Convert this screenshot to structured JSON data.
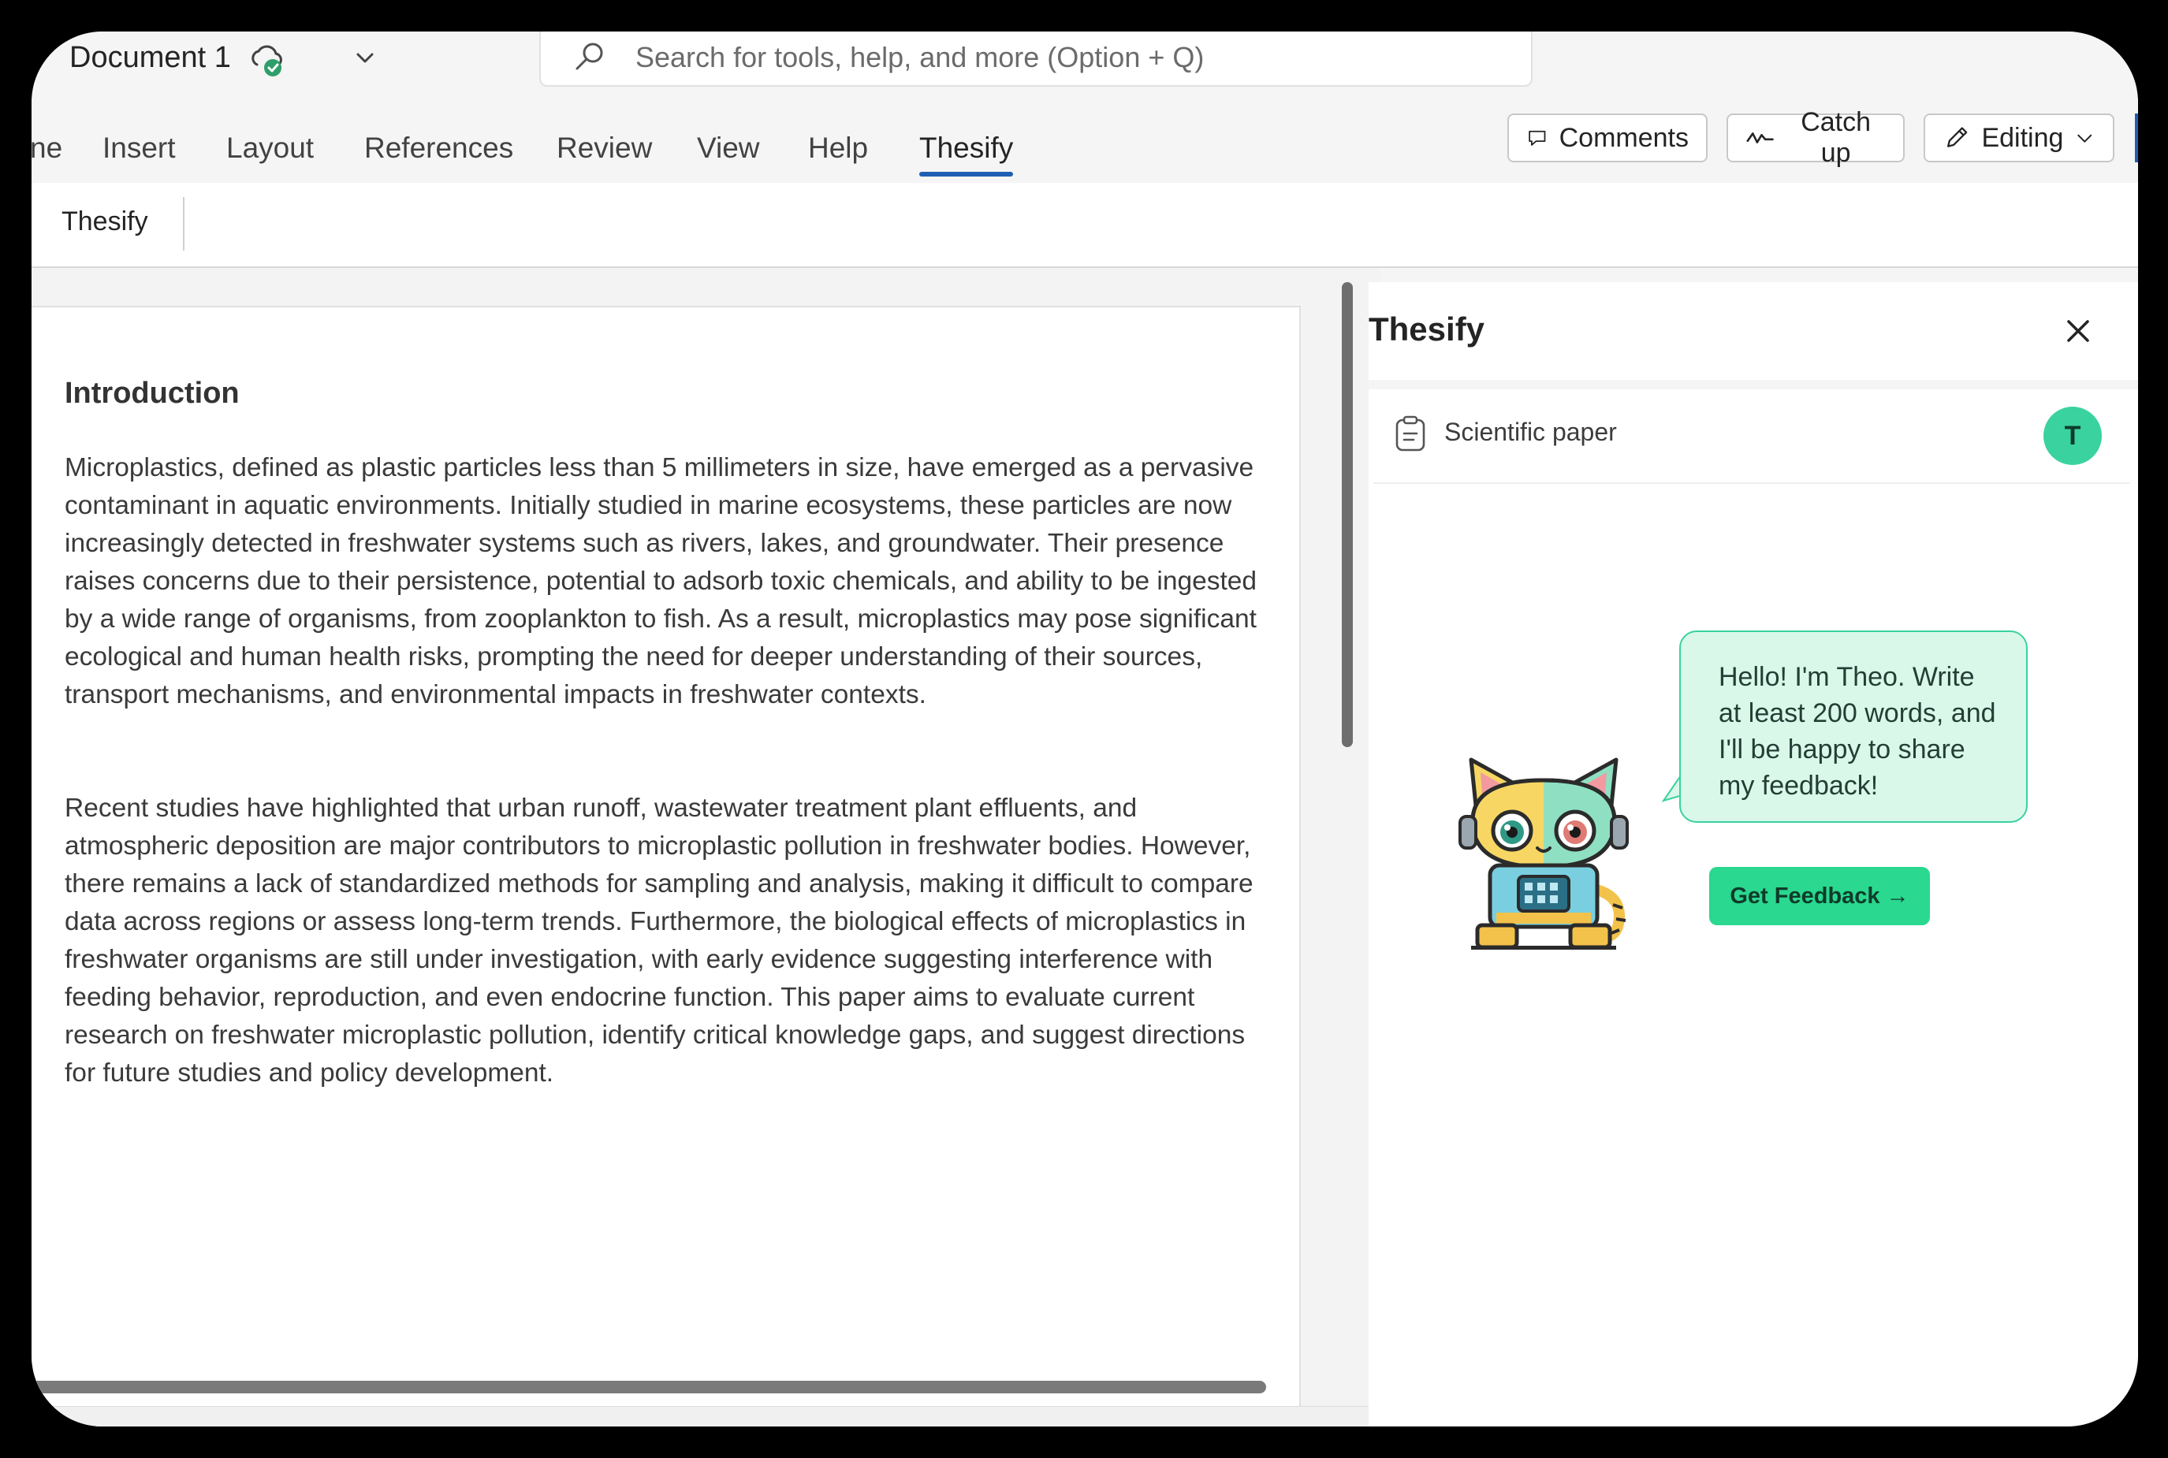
{
  "titlebar": {
    "document_title": "Document 1",
    "search_placeholder": "Search for tools, help, and more (Option + Q)"
  },
  "ribbon": {
    "tabs": [
      {
        "label": "ne"
      },
      {
        "label": "Insert"
      },
      {
        "label": "Layout"
      },
      {
        "label": "References"
      },
      {
        "label": "Review"
      },
      {
        "label": "View"
      },
      {
        "label": "Help"
      },
      {
        "label": "Thesify",
        "active": true
      }
    ],
    "comments_label": "Comments",
    "catchup_label": "Catch up",
    "editing_label": "Editing",
    "subribbon_label": "Thesify"
  },
  "document": {
    "heading": "Introduction",
    "paragraphs": [
      "Microplastics, defined as plastic particles less than 5 millimeters in size, have emerged as a pervasive contaminant in aquatic environments. Initially studied in marine ecosystems, these particles are now increasingly detected in freshwater systems such as rivers, lakes, and groundwater. Their presence raises concerns due to their persistence, potential to adsorb toxic chemicals, and ability to be ingested by a wide range of organisms, from zooplankton to fish. As a result, microplastics may pose significant ecological and human health risks, prompting the need for deeper understanding of their sources, transport mechanisms, and environmental impacts in freshwater contexts.",
      "Recent studies have highlighted that urban runoff, wastewater treatment plant effluents, and atmospheric deposition are major contributors to microplastic pollution in freshwater bodies. However, there remains a lack of standardized methods for sampling and analysis, making it difficult to compare data across regions or assess long-term trends. Furthermore, the biological effects of microplastics in freshwater organisms are still under investigation, with early evidence suggesting interference with feeding behavior, reproduction, and even endocrine function. This paper aims to evaluate current research on freshwater microplastic pollution, identify critical knowledge gaps, and suggest directions for future studies and policy development."
    ]
  },
  "pane": {
    "title": "Thesify",
    "doc_type": "Scientific paper",
    "avatar_initial": "T",
    "bubble_text": "Hello! I'm Theo. Write at least 200 words, and I'll be happy to share my feedback!",
    "feedback_button": "Get Feedback →"
  },
  "colors": {
    "accent_blue": "#1f5fb3",
    "thesify_green": "#2ad88f",
    "bubble_bg": "#d9f8ea"
  },
  "icons": [
    "cloud-check-icon",
    "chevron-down-icon",
    "search-icon",
    "comment-icon",
    "catch-up-icon",
    "pencil-icon",
    "close-icon",
    "document-icon"
  ]
}
